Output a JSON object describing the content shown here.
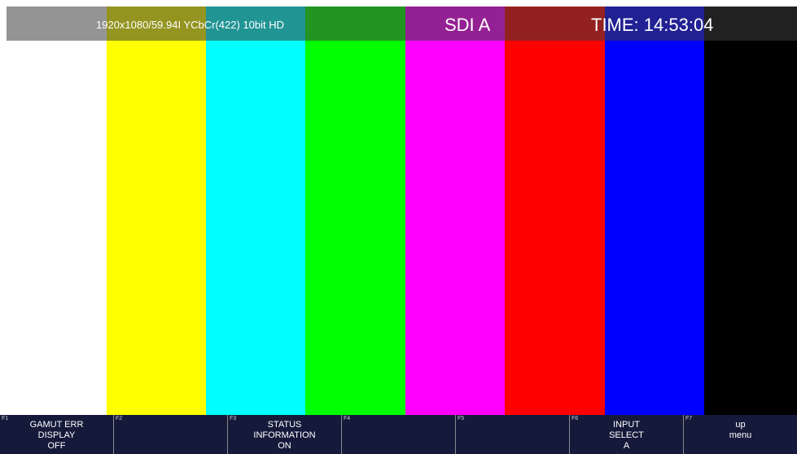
{
  "status": {
    "format": "1920x1080/59.94I YCbCr(422) 10bit HD",
    "input": "SDI A",
    "time": "TIME: 14:53:04"
  },
  "color_bars": [
    {
      "name": "white",
      "color": "#ffffff"
    },
    {
      "name": "yellow",
      "color": "#ffff00"
    },
    {
      "name": "cyan",
      "color": "#00ffff"
    },
    {
      "name": "green",
      "color": "#00ff00"
    },
    {
      "name": "magenta",
      "color": "#ff00ff"
    },
    {
      "name": "red",
      "color": "#ff0000"
    },
    {
      "name": "blue",
      "color": "#0000ff"
    },
    {
      "name": "black",
      "color": "#000000"
    }
  ],
  "function_keys": [
    {
      "key": "F1",
      "label": "GAMUT ERR\nDISPLAY\nOFF"
    },
    {
      "key": "F2",
      "label": ""
    },
    {
      "key": "F3",
      "label": "STATUS\nINFORMATION\nON"
    },
    {
      "key": "F4",
      "label": ""
    },
    {
      "key": "F5",
      "label": ""
    },
    {
      "key": "F6",
      "label": "INPUT\nSELECT\nA"
    },
    {
      "key": "F7",
      "label": "up\nmenu"
    }
  ],
  "colors": {
    "menu_background": "#151a3b",
    "status_overlay": "rgba(60,60,60,0.55)"
  }
}
